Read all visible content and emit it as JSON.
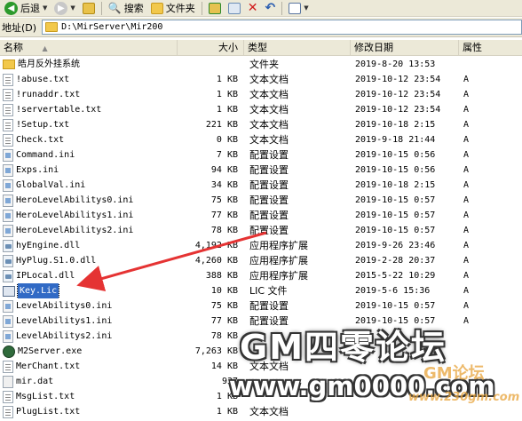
{
  "toolbar": {
    "back_label": "后退",
    "search_label": "搜索",
    "folders_label": "文件夹"
  },
  "address": {
    "label": "地址(D)",
    "path": "D:\\MirServer\\Mir200"
  },
  "columns": {
    "name": "名称",
    "size": "大小",
    "type": "类型",
    "modified": "修改日期",
    "attr": "属性"
  },
  "files": [
    {
      "name": "皓月反外挂系统",
      "size": "",
      "type": "文件夹",
      "modified": "2019-8-20 13:53",
      "attr": "",
      "icon": "folder-icon"
    },
    {
      "name": "!abuse.txt",
      "size": "1 KB",
      "type": "文本文档",
      "modified": "2019-10-12 23:54",
      "attr": "A",
      "icon": "text-file-icon"
    },
    {
      "name": "!runaddr.txt",
      "size": "1 KB",
      "type": "文本文档",
      "modified": "2019-10-12 23:54",
      "attr": "A",
      "icon": "text-file-icon"
    },
    {
      "name": "!servertable.txt",
      "size": "1 KB",
      "type": "文本文档",
      "modified": "2019-10-12 23:54",
      "attr": "A",
      "icon": "text-file-icon"
    },
    {
      "name": "!Setup.txt",
      "size": "221 KB",
      "type": "文本文档",
      "modified": "2019-10-18 2:15",
      "attr": "A",
      "icon": "text-file-icon"
    },
    {
      "name": "Check.txt",
      "size": "0 KB",
      "type": "文本文档",
      "modified": "2019-9-18 21:44",
      "attr": "A",
      "icon": "text-file-icon"
    },
    {
      "name": "Command.ini",
      "size": "7 KB",
      "type": "配置设置",
      "modified": "2019-10-15 0:56",
      "attr": "A",
      "icon": "config-file-icon"
    },
    {
      "name": "Exps.ini",
      "size": "94 KB",
      "type": "配置设置",
      "modified": "2019-10-15 0:56",
      "attr": "A",
      "icon": "config-file-icon"
    },
    {
      "name": "GlobalVal.ini",
      "size": "34 KB",
      "type": "配置设置",
      "modified": "2019-10-18 2:15",
      "attr": "A",
      "icon": "config-file-icon"
    },
    {
      "name": "HeroLevelAbilitys0.ini",
      "size": "75 KB",
      "type": "配置设置",
      "modified": "2019-10-15 0:57",
      "attr": "A",
      "icon": "config-file-icon"
    },
    {
      "name": "HeroLevelAbilitys1.ini",
      "size": "77 KB",
      "type": "配置设置",
      "modified": "2019-10-15 0:57",
      "attr": "A",
      "icon": "config-file-icon"
    },
    {
      "name": "HeroLevelAbilitys2.ini",
      "size": "78 KB",
      "type": "配置设置",
      "modified": "2019-10-15 0:57",
      "attr": "A",
      "icon": "config-file-icon"
    },
    {
      "name": "hyEngine.dll",
      "size": "4,192 KB",
      "type": "应用程序扩展",
      "modified": "2019-9-26 23:46",
      "attr": "A",
      "icon": "dll-file-icon"
    },
    {
      "name": "HyPlug.S1.0.dll",
      "size": "4,260 KB",
      "type": "应用程序扩展",
      "modified": "2019-2-28 20:37",
      "attr": "A",
      "icon": "dll-file-icon"
    },
    {
      "name": "IPLocal.dll",
      "size": "388 KB",
      "type": "应用程序扩展",
      "modified": "2015-5-22 10:29",
      "attr": "A",
      "icon": "dll-file-icon"
    },
    {
      "name": "Key.Lic",
      "size": "10 KB",
      "type": "LIC 文件",
      "modified": "2019-5-6 15:36",
      "attr": "A",
      "icon": "license-file-icon",
      "selected": true
    },
    {
      "name": "LevelAbilitys0.ini",
      "size": "75 KB",
      "type": "配置设置",
      "modified": "2019-10-15 0:57",
      "attr": "A",
      "icon": "config-file-icon"
    },
    {
      "name": "LevelAbilitys1.ini",
      "size": "77 KB",
      "type": "配置设置",
      "modified": "2019-10-15 0:57",
      "attr": "A",
      "icon": "config-file-icon"
    },
    {
      "name": "LevelAbilitys2.ini",
      "size": "78 KB",
      "type": "",
      "modified": "",
      "attr": "",
      "icon": "config-file-icon"
    },
    {
      "name": "M2Server.exe",
      "size": "7,263 KB",
      "type": "",
      "modified": "",
      "attr": "",
      "icon": "exe-file-icon"
    },
    {
      "name": "MerChant.txt",
      "size": "14 KB",
      "type": "文本文档",
      "modified": "",
      "attr": "",
      "icon": "text-file-icon"
    },
    {
      "name": "mir.dat",
      "size": "937",
      "type": "",
      "modified": "",
      "attr": "",
      "icon": "dat-file-icon"
    },
    {
      "name": "MsgList.txt",
      "size": "1 KB",
      "type": "",
      "modified": "",
      "attr": "",
      "icon": "text-file-icon"
    },
    {
      "name": "PlugList.txt",
      "size": "1 KB",
      "type": "文本文档",
      "modified": "",
      "attr": "",
      "icon": "text-file-icon"
    }
  ],
  "watermark": {
    "title": "GM四零论坛",
    "url": "www.gm0000.com",
    "logo_text": "GM论坛",
    "logo_url": "www.230gm.com"
  }
}
